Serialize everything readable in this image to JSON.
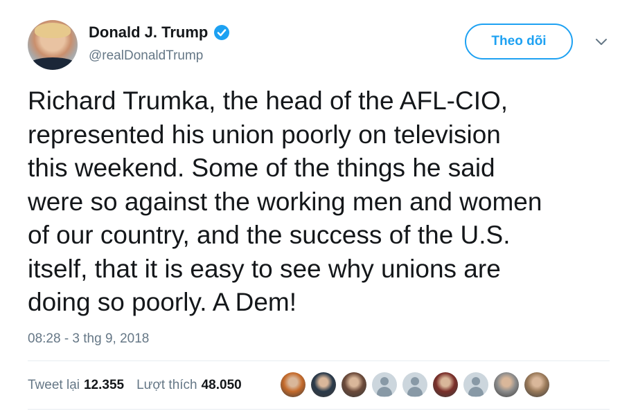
{
  "author": {
    "name": "Donald J. Trump",
    "handle": "@realDonaldTrump",
    "verified": true
  },
  "follow_button": {
    "label": "Theo dõi"
  },
  "tweet": {
    "text": "Richard Trumka, the head of the AFL-CIO,\nrepresented his union poorly on television\nthis weekend. Some of the things he said\nwere so against the working men and women\nof our country, and the success of the U.S.\nitself, that it is easy to see why unions are\ndoing so poorly. A Dem!",
    "timestamp": "08:28 - 3 thg 9, 2018"
  },
  "stats": {
    "retweets_label": "Tweet lại",
    "retweets_count": "12.355",
    "likes_label": "Lượt thích",
    "likes_count": "48.050"
  },
  "likers": [
    {
      "kind": "photo",
      "color": "#c46a2b"
    },
    {
      "kind": "photo",
      "color": "#2a3a4a"
    },
    {
      "kind": "photo",
      "color": "#6b4a3a"
    },
    {
      "kind": "default"
    },
    {
      "kind": "default"
    },
    {
      "kind": "photo",
      "color": "#7a2f2a"
    },
    {
      "kind": "default"
    },
    {
      "kind": "photo",
      "color": "#8c8c8c"
    },
    {
      "kind": "photo",
      "color": "#9a7a5a"
    }
  ],
  "colors": {
    "accent": "#1da1f2",
    "secondary_text": "#657786",
    "primary_text": "#14171a",
    "divider": "#e6ecf0"
  }
}
